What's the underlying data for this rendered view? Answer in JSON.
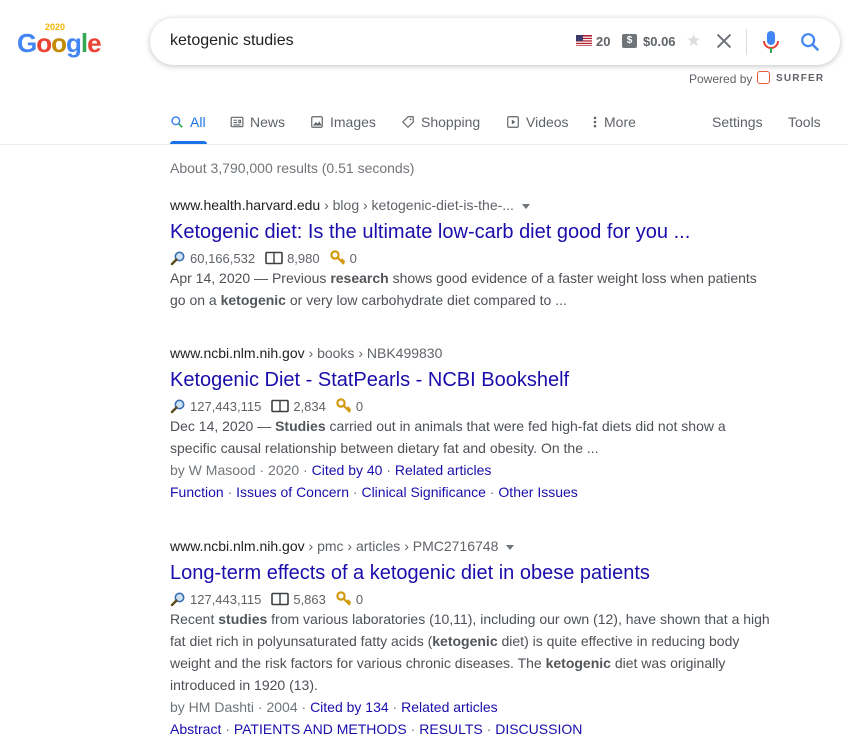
{
  "logo": {
    "letters": [
      "G",
      "o",
      "o",
      "g",
      "l",
      "e"
    ],
    "year": "2020"
  },
  "search": {
    "query": "ketogenic studies",
    "volume": "20",
    "dollar_badge": "$",
    "cpc": "$0.06"
  },
  "powered": {
    "label": "Powered by",
    "brand": "SURFER"
  },
  "tabs": [
    {
      "label": "All"
    },
    {
      "label": "News"
    },
    {
      "label": "Images"
    },
    {
      "label": "Shopping"
    },
    {
      "label": "Videos"
    },
    {
      "label": "More"
    },
    {
      "label": "Settings"
    },
    {
      "label": "Tools"
    }
  ],
  "stats": "About 3,790,000 results (0.51 seconds)",
  "results": [
    {
      "domain": "www.health.harvard.edu",
      "path": " › blog › ketogenic-diet-is-the-...",
      "title": "Ketogenic diet: Is the ultimate low-carb diet good for you ...",
      "traffic": "60,166,532",
      "pages": "8,980",
      "keys": "0",
      "snippet_lines": [
        [
          {
            "t": "Apr 14, 2020 — Previous "
          },
          {
            "t": "research",
            "b": true
          },
          {
            "t": " shows good evidence of a faster weight loss when patients"
          }
        ],
        [
          {
            "t": "go on a "
          },
          {
            "t": "ketogenic",
            "b": true
          },
          {
            "t": " or very low carbohydrate diet compared to ..."
          }
        ]
      ]
    },
    {
      "domain": "www.ncbi.nlm.nih.gov",
      "path": " › books › NBK499830",
      "title": "Ketogenic Diet - StatPearls - NCBI Bookshelf",
      "traffic": "127,443,115",
      "pages": "2,834",
      "keys": "0",
      "snippet_lines": [
        [
          {
            "t": "Dec 14, 2020 — "
          },
          {
            "t": "Studies",
            "b": true
          },
          {
            "t": " carried out in animals that were fed high-fat diets did not show a"
          }
        ],
        [
          {
            "t": "specific causal relationship between dietary fat and obesity. On the ..."
          }
        ]
      ],
      "byline": {
        "author": "by W Masood · 2020 · ",
        "cited": "Cited by 40",
        "sep": " · ",
        "related": "Related articles"
      },
      "sitelinks": [
        "Function",
        "Issues of Concern",
        "Clinical Significance",
        "Other Issues"
      ]
    },
    {
      "domain": "www.ncbi.nlm.nih.gov",
      "path": " › pmc › articles › PMC2716748",
      "title": "Long-term effects of a ketogenic diet in obese patients",
      "traffic": "127,443,115",
      "pages": "5,863",
      "keys": "0",
      "snippet_lines": [
        [
          {
            "t": "Recent "
          },
          {
            "t": "studies",
            "b": true
          },
          {
            "t": " from various laboratories (10,11), including our own (12), have shown that a high"
          }
        ],
        [
          {
            "t": "fat diet rich in polyunsaturated fatty acids ("
          },
          {
            "t": "ketogenic",
            "b": true
          },
          {
            "t": " diet) is quite effective in reducing body"
          }
        ],
        [
          {
            "t": "weight and the risk factors for various chronic diseases. The "
          },
          {
            "t": "ketogenic",
            "b": true
          },
          {
            "t": " diet was originally"
          }
        ],
        [
          {
            "t": "introduced in 1920 (13)."
          }
        ]
      ],
      "byline": {
        "author": "by HM Dashti · 2004 · ",
        "cited": "Cited by 134",
        "sep": " · ",
        "related": "Related articles"
      },
      "sitelinks": [
        "Abstract",
        "PATIENTS AND METHODS",
        "RESULTS",
        "DISCUSSION"
      ]
    }
  ],
  "colors": {
    "link": "#1a0dab",
    "accent": "#1a73e8",
    "text_muted": "#70757a"
  }
}
